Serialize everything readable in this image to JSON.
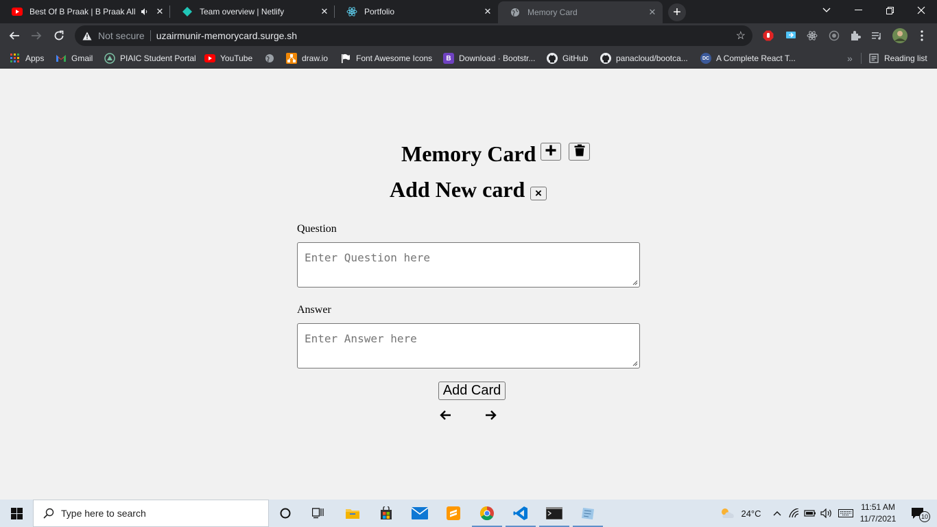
{
  "browser": {
    "tabs": [
      {
        "title": "Best Of B Praak | B Praak All",
        "icon": "youtube-icon",
        "audio": true
      },
      {
        "title": "Team overview | Netlify",
        "icon": "netlify-icon"
      },
      {
        "title": "Portfolio",
        "icon": "react-icon"
      },
      {
        "title": "Memory Card",
        "icon": "globe-icon",
        "active": true
      }
    ],
    "new_tab_label": "+",
    "security_label": "Not secure",
    "url": "uzairmunir-memorycard.surge.sh",
    "bookmarks": [
      {
        "label": "Apps",
        "icon": "apps-grid-icon"
      },
      {
        "label": "Gmail",
        "icon": "gmail-icon"
      },
      {
        "label": "PIAIC Student Portal",
        "icon": "piaic-icon"
      },
      {
        "label": "YouTube",
        "icon": "youtube-icon"
      },
      {
        "label": "",
        "icon": "globe-icon"
      },
      {
        "label": "draw.io",
        "icon": "drawio-icon"
      },
      {
        "label": "Font Awesome Icons",
        "icon": "flag-icon"
      },
      {
        "label": "Download · Bootstr...",
        "icon": "bootstrap-icon"
      },
      {
        "label": "GitHub",
        "icon": "github-icon"
      },
      {
        "label": "panacloud/bootca...",
        "icon": "github-icon"
      },
      {
        "label": "A Complete React T...",
        "icon": "dc-icon"
      }
    ],
    "overflow_label": "»",
    "reading_list_label": "Reading list"
  },
  "page": {
    "title": "Memory Card",
    "subtitle": "Add New card",
    "close_label": "×",
    "question_label": "Question",
    "question_placeholder": "Enter Question here",
    "answer_label": "Answer",
    "answer_placeholder": "Enter Answer here",
    "add_button_label": "Add Card"
  },
  "taskbar": {
    "search_placeholder": "Type here to search",
    "weather": "24°C",
    "time": "11:51 AM",
    "date": "11/7/2021",
    "notification_count": "10"
  },
  "colors": {
    "page_bg": "#f1f1f1",
    "tab_bar": "#202124",
    "toolbar": "#35363a",
    "taskbar": "#dde6ef"
  }
}
